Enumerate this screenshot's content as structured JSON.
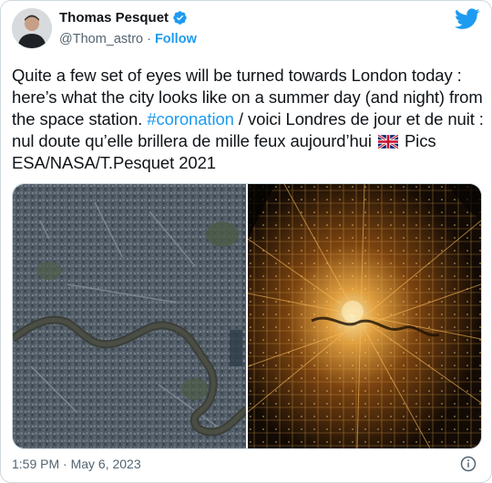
{
  "author": {
    "name": "Thomas Pesquet",
    "handle": "@Thom_astro",
    "dot": "·",
    "follow_label": "Follow"
  },
  "tweet": {
    "text_before": "Quite a few set of eyes will be turned towards London today : here’s what the city looks like on a summer day (and night) from the space station. ",
    "hashtag": "#coronation",
    "text_after": " / voici Londres de jour et de nuit : nul doute qu’elle brillera de mille feux aujourd’hui ",
    "credit": " Pics ESA/NASA/T.Pesquet 2021"
  },
  "timestamp": "1:59 PM · May 6, 2023",
  "colors": {
    "accent": "#1d9bf0",
    "text": "#0f1419",
    "muted": "#536471"
  },
  "icons": [
    "verified-badge-icon",
    "twitter-bird-icon",
    "uk-flag-icon",
    "info-icon"
  ]
}
